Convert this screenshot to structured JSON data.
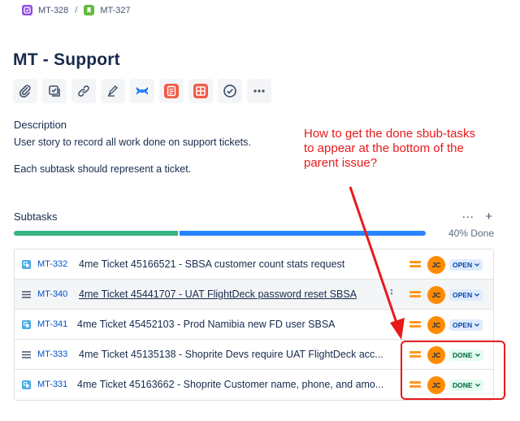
{
  "breadcrumb": {
    "parent_key": "MT-328",
    "separator": "/",
    "current_key": "MT-327"
  },
  "issue": {
    "title": "MT - Support"
  },
  "toolbar": {
    "buttons": [
      "attach-icon",
      "create-subtask-icon",
      "link-icon",
      "edit-icon",
      "confluence-icon",
      "app-icon",
      "grid-app-icon",
      "checklist-icon",
      "more-icon"
    ]
  },
  "description": {
    "label": "Description",
    "line1": "User story to record all work done on support tickets.",
    "line2": "Each subtask should represent a ticket."
  },
  "annotation": {
    "text": "How to get the done sbub-tasks to appear at the bottom of the parent issue?",
    "color": "#e8191b"
  },
  "subtasks": {
    "label": "Subtasks",
    "more": "···",
    "add": "+",
    "progress_done_fraction": 0.4,
    "progress_text": "40% Done",
    "colors": {
      "done": "#36b37e",
      "remaining": "#2684ff"
    },
    "rows": [
      {
        "type": "subtask",
        "key": "MT-332",
        "summary": "4me Ticket 45166521 - SBSA customer count stats request",
        "assignee": "JC",
        "status": "OPEN"
      },
      {
        "type": "story-lines",
        "key": "MT-340",
        "summary": "4me Ticket 45441707 - UAT FlightDeck password reset SBSA",
        "assignee": "JC",
        "status": "OPEN"
      },
      {
        "type": "subtask",
        "key": "MT-341",
        "summary": "4me Ticket 45452103 - Prod Namibia new FD user SBSA",
        "assignee": "JC",
        "status": "OPEN"
      },
      {
        "type": "story-lines",
        "key": "MT-333",
        "summary": "4me Ticket 45135138 - Shoprite Devs require UAT FlightDeck acc...",
        "assignee": "JC",
        "status": "DONE"
      },
      {
        "type": "subtask",
        "key": "MT-331",
        "summary": "4me Ticket 45163662 - Shoprite Customer name, phone, and amo...",
        "assignee": "JC",
        "status": "DONE"
      }
    ]
  }
}
